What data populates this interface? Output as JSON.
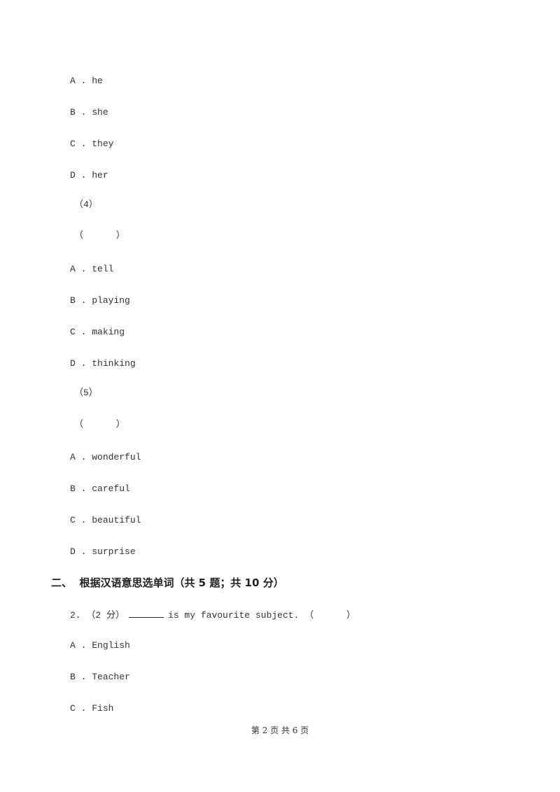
{
  "question1_continued": {
    "sub3_options": [
      {
        "letter": "A .",
        "text": "he"
      },
      {
        "letter": "B .",
        "text": "she"
      },
      {
        "letter": "C .",
        "text": "they"
      },
      {
        "letter": "D .",
        "text": "her"
      }
    ],
    "sub4": {
      "label": "（4）",
      "paren": "（      ）",
      "options": [
        {
          "letter": "A .",
          "text": "tell"
        },
        {
          "letter": "B .",
          "text": "playing"
        },
        {
          "letter": "C .",
          "text": "making"
        },
        {
          "letter": "D .",
          "text": "thinking"
        }
      ]
    },
    "sub5": {
      "label": "（5）",
      "paren": "（      ）",
      "options": [
        {
          "letter": "A .",
          "text": "wonderful"
        },
        {
          "letter": "B .",
          "text": "careful"
        },
        {
          "letter": "C .",
          "text": "beautiful"
        },
        {
          "letter": "D .",
          "text": "surprise"
        }
      ]
    }
  },
  "section2": {
    "title": "二、  根据汉语意思选单词（共 5 题；共 10 分）"
  },
  "question2": {
    "number": "2.",
    "score": "（2 分）",
    "text": "is my favourite subject.",
    "paren": "（      ）",
    "options": [
      {
        "letter": "A .",
        "text": "English"
      },
      {
        "letter": "B .",
        "text": "Teacher"
      },
      {
        "letter": "C .",
        "text": "Fish"
      }
    ]
  },
  "footer": {
    "page_text": "第 2 页 共 6 页"
  }
}
